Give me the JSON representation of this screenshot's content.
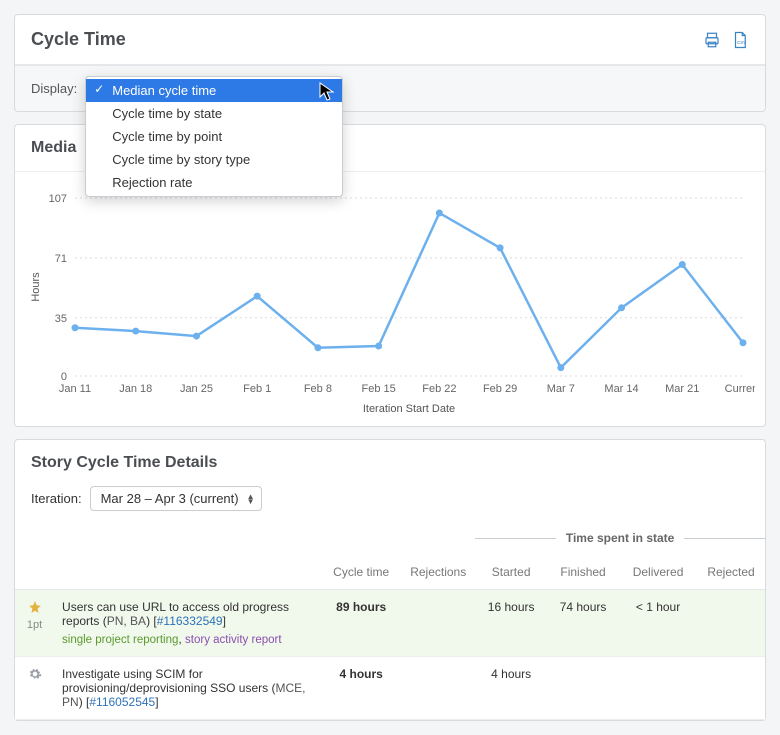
{
  "header": {
    "title": "Cycle Time"
  },
  "display": {
    "label": "Display:",
    "selected": "Median cycle time",
    "options": [
      "Median cycle time",
      "Cycle time by state",
      "Cycle time by point",
      "Cycle time by story type",
      "Rejection rate"
    ]
  },
  "chart_title_visible": "Media",
  "chart_data": {
    "type": "line",
    "title": "Median Cycle Time",
    "xlabel": "Iteration Start Date",
    "ylabel": "Hours",
    "ylim": [
      0,
      107
    ],
    "yticks": [
      0,
      35,
      71,
      107
    ],
    "categories": [
      "Jan 11",
      "Jan 18",
      "Jan 25",
      "Feb 1",
      "Feb 8",
      "Feb 15",
      "Feb 22",
      "Feb 29",
      "Mar 7",
      "Mar 14",
      "Mar 21",
      "Current"
    ],
    "values": [
      29,
      27,
      24,
      48,
      17,
      18,
      98,
      77,
      5,
      41,
      67,
      20
    ]
  },
  "details": {
    "title": "Story Cycle Time Details",
    "iteration_label": "Iteration:",
    "iteration_value": "Mar 28 – Apr 3 (current)",
    "group_header": "Time spent in state",
    "columns": {
      "cycle": "Cycle time",
      "rejections": "Rejections",
      "started": "Started",
      "finished": "Finished",
      "delivered": "Delivered",
      "rejected": "Rejected"
    },
    "rows": [
      {
        "kind": "feature",
        "points": "1pt",
        "title_pre": "Users can use URL to access old progress reports (",
        "initials": "PN, BA",
        "title_mid": ") [",
        "ticket": "#116332549",
        "title_post": "]",
        "tags": [
          {
            "text": "single project reporting",
            "class": "tag-green"
          },
          {
            "text": "story activity report",
            "class": "tag-purple"
          }
        ],
        "cycle": "89 hours",
        "rejections": "",
        "started": "16 hours",
        "finished": "74 hours",
        "delivered": "< 1 hour",
        "rejected": ""
      },
      {
        "kind": "chore",
        "points": "",
        "title_pre": "Investigate using SCIM for provisioning/deprovisioning SSO users (",
        "initials": "MCE, PN",
        "title_mid": ") [",
        "ticket": "#116052545",
        "title_post": "]",
        "tags": [],
        "cycle": "4 hours",
        "rejections": "",
        "started": "4 hours",
        "finished": "",
        "delivered": "",
        "rejected": ""
      }
    ]
  }
}
